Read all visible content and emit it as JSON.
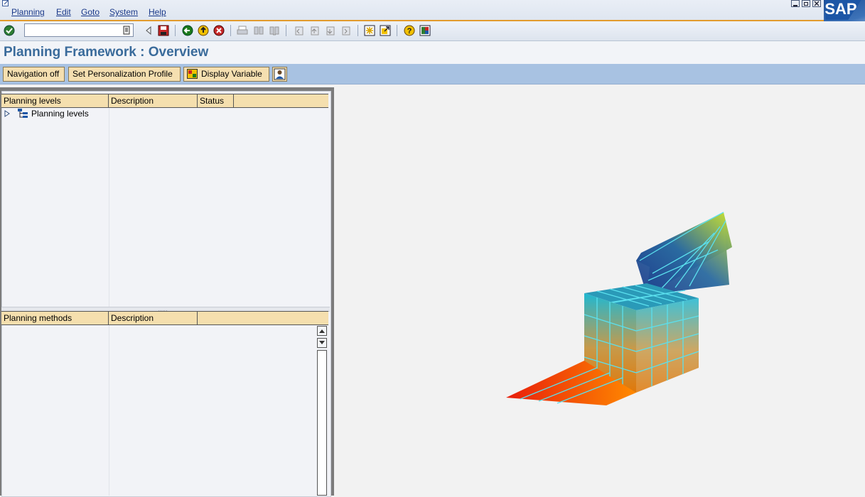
{
  "menu": {
    "items": [
      "Planning",
      "Edit",
      "Goto",
      "System",
      "Help"
    ]
  },
  "toolbar": {
    "command_field": "",
    "icons": [
      "enter-icon",
      "back-icon",
      "save-icon",
      "back-green-icon",
      "exit-icon",
      "cancel-icon",
      "print-icon",
      "find-icon",
      "find-next-icon",
      "first-page-icon",
      "previous-page-icon",
      "next-page-icon",
      "last-page-icon",
      "create-session-icon",
      "shortcut-icon",
      "help-icon",
      "customize-layout-icon"
    ]
  },
  "page": {
    "title": "Planning Framework : Overview"
  },
  "app_toolbar": {
    "navigation_off": "Navigation off",
    "set_profile": "Set Personalization Profile",
    "display_variable": "Display Variable"
  },
  "levels_grid": {
    "columns": [
      "Planning levels",
      "Description",
      "Status",
      ""
    ],
    "rows": [
      {
        "label": "Planning levels"
      }
    ]
  },
  "methods_grid": {
    "columns": [
      "Planning methods",
      "Description",
      ""
    ]
  },
  "branding": {
    "logo_text": "SAP",
    "accent": "#e29b2d",
    "title_color": "#3a6b9b",
    "header_fill": "#f5dfae"
  }
}
